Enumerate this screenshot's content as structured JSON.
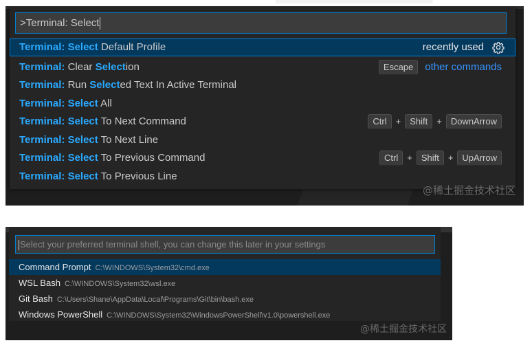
{
  "panel1": {
    "input": {
      "value": ">Terminal: Select"
    },
    "recently_used": "recently used",
    "other_commands": "other commands",
    "items": [
      {
        "prefix": "Terminal:",
        "match": "Select",
        "rest": " Default Profile",
        "style": "full"
      },
      {
        "prefix": "Terminal:",
        "pre": " Clear ",
        "match": "Select",
        "rest": "ion",
        "keys": [
          "Escape"
        ]
      },
      {
        "prefix": "Terminal:",
        "pre": " Run ",
        "match": "Select",
        "rest": "ed Text In Active Terminal"
      },
      {
        "prefix": "Terminal:",
        "match": "Select",
        "rest": " All"
      },
      {
        "prefix": "Terminal:",
        "match": "Select",
        "rest": " To Next Command",
        "keys": [
          "Ctrl",
          "Shift",
          "DownArrow"
        ]
      },
      {
        "prefix": "Terminal:",
        "match": "Select",
        "rest": " To Next Line"
      },
      {
        "prefix": "Terminal:",
        "match": "Select",
        "rest": " To Previous Command",
        "keys": [
          "Ctrl",
          "Shift",
          "UpArrow"
        ]
      },
      {
        "prefix": "Terminal:",
        "match": "Select",
        "rest": " To Previous Line"
      }
    ],
    "watermark": "@稀土掘金技术社区"
  },
  "panel2": {
    "input": {
      "placeholder": "Select your preferred terminal shell, you can change this later in your settings"
    },
    "items": [
      {
        "name": "Command Prompt",
        "path": "C:\\WINDOWS\\System32\\cmd.exe"
      },
      {
        "name": "WSL Bash",
        "path": "C:\\WINDOWS\\System32\\wsl.exe"
      },
      {
        "name": "Git Bash",
        "path": "C:\\Users\\Shane\\AppData\\Local\\Programs\\Git\\bin\\bash.exe"
      },
      {
        "name": "Windows PowerShell",
        "path": "C:\\WINDOWS\\System32\\WindowsPowerShell\\v1.0\\powershell.exe"
      }
    ],
    "watermark": "@稀土掘金技术社区"
  },
  "colors": {
    "highlight": "#2aaaff",
    "selection_bg": "#04395e",
    "focus_border": "#007fd4",
    "link": "#3794ff"
  }
}
